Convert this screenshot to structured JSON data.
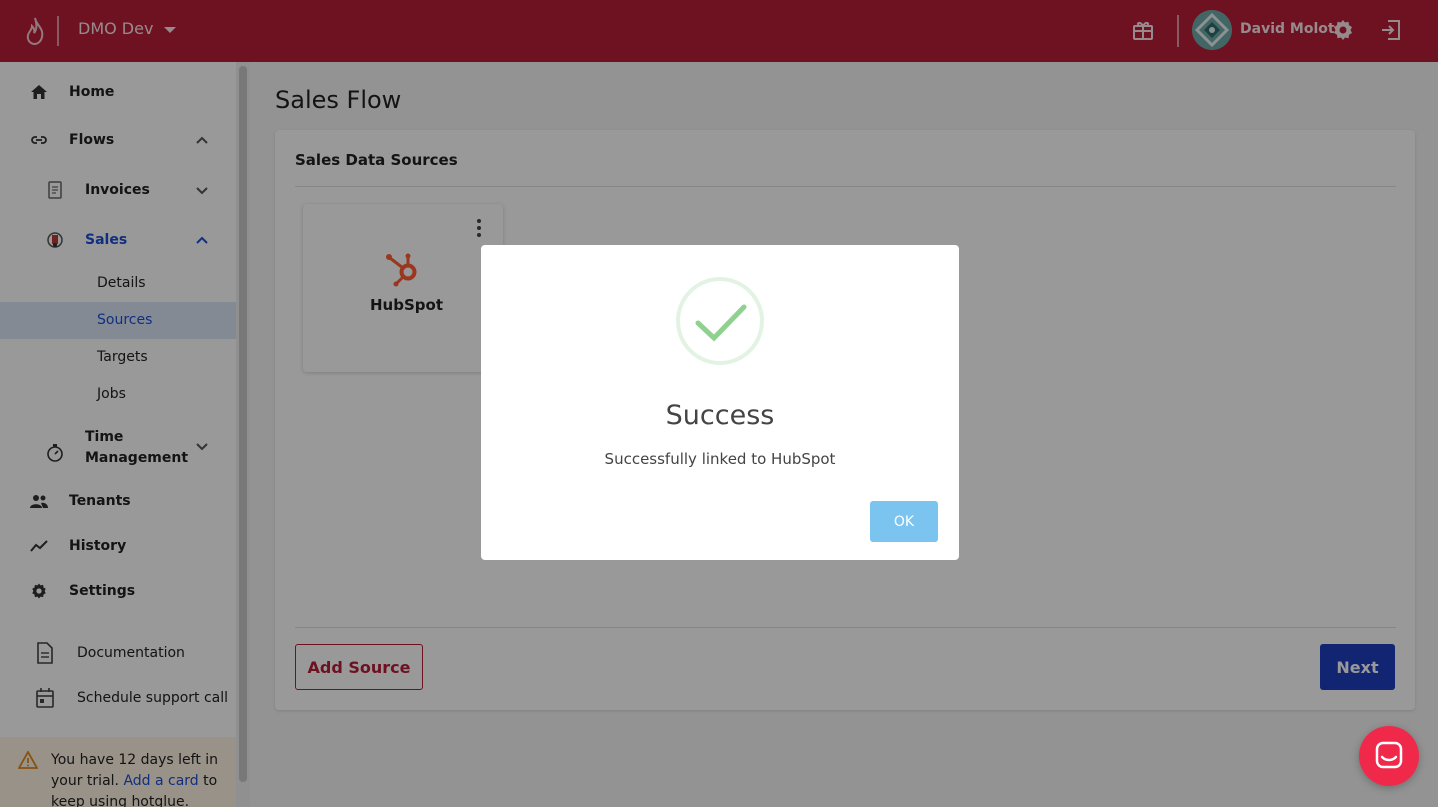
{
  "topbar": {
    "environment": "DMO Dev",
    "user_name": "David Molot",
    "icons": [
      "flame-logo-icon",
      "gift-icon",
      "gear-icon",
      "logout-icon"
    ]
  },
  "sidebar": {
    "items": [
      {
        "label": "Home",
        "icon": "home-icon"
      },
      {
        "label": "Flows",
        "icon": "link-icon"
      },
      {
        "label": "Invoices",
        "icon": "invoice-icon"
      },
      {
        "label": "Sales",
        "icon": "sales-icon"
      },
      {
        "label": "Details"
      },
      {
        "label": "Sources"
      },
      {
        "label": "Targets"
      },
      {
        "label": "Jobs"
      },
      {
        "label": "Time Management",
        "icon": "stopwatch-icon"
      },
      {
        "label": "Tenants",
        "icon": "people-icon"
      },
      {
        "label": "History",
        "icon": "trend-icon"
      },
      {
        "label": "Settings",
        "icon": "gear-icon"
      },
      {
        "label": "Documentation",
        "icon": "document-icon"
      },
      {
        "label": "Schedule support call",
        "icon": "calendar-icon"
      }
    ],
    "time_management_line1": "Time",
    "time_management_line2": "Management",
    "trial_prefix": "You have 12 days left in your trial.",
    "trial_link": "Add a card",
    "trial_suffix": "to keep using hotglue."
  },
  "main": {
    "page_title": "Sales Flow",
    "card_title": "Sales Data Sources",
    "source_name": "HubSpot",
    "add_source_label": "Add Source",
    "next_label": "Next"
  },
  "modal": {
    "title": "Success",
    "message": "Successfully linked to HubSpot",
    "ok_label": "OK"
  },
  "colors": {
    "brand": "#b81e3a",
    "primary_button": "#1d3fbf",
    "ok_button": "#7cc4f0",
    "success_check": "#8fd18f",
    "chat_bubble": "#f0294a"
  }
}
